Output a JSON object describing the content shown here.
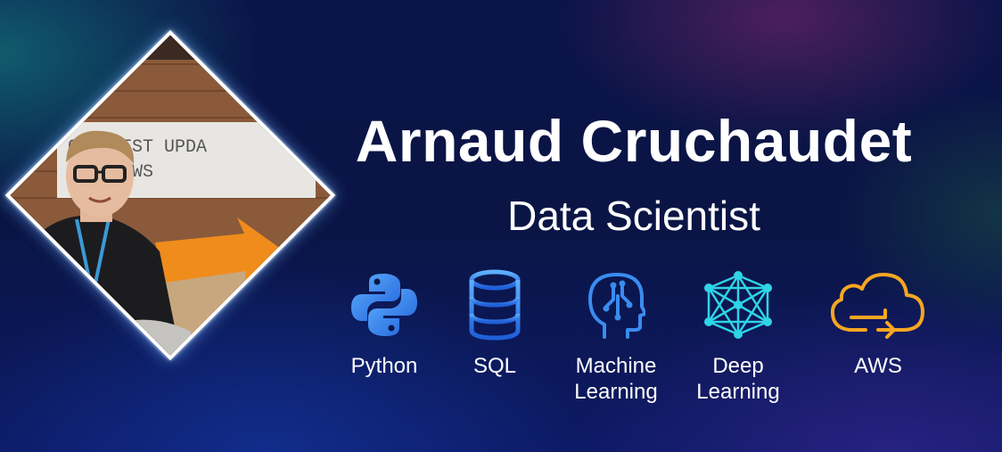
{
  "profile": {
    "name": "Arnaud Cruchaudet",
    "title": "Data Scientist"
  },
  "photo": {
    "sign_text_line1": "G  EATEST UPDA",
    "sign_text_line2": "  0 Z NEWS"
  },
  "skills": [
    {
      "icon": "python-icon",
      "label_line1": "Python",
      "label_line2": ""
    },
    {
      "icon": "database-icon",
      "label_line1": "SQL",
      "label_line2": ""
    },
    {
      "icon": "brain-head-icon",
      "label_line1": "Machine",
      "label_line2": "Learning"
    },
    {
      "icon": "neural-network-icon",
      "label_line1": "Deep",
      "label_line2": "Learning"
    },
    {
      "icon": "cloud-icon",
      "label_line1": "AWS",
      "label_line2": ""
    }
  ],
  "colors": {
    "background": "#0a1140",
    "icon_blue": "#3a8cf0",
    "icon_cyan": "#2fd4e6",
    "icon_orange": "#f5a623"
  }
}
